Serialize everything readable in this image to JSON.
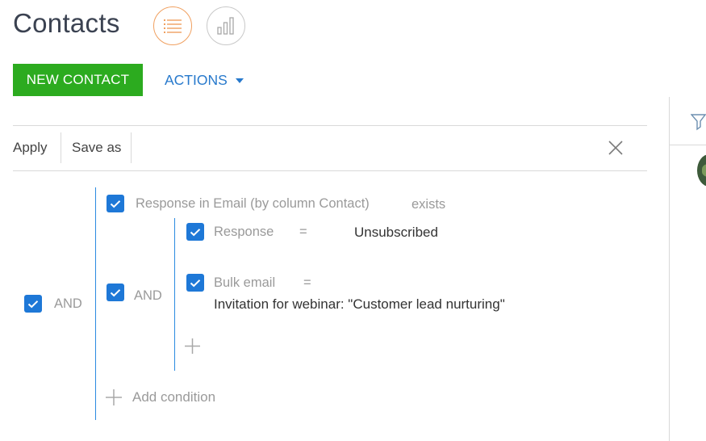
{
  "header": {
    "title": "Contacts"
  },
  "toolbar": {
    "new_contact_label": "NEW CONTACT",
    "actions_label": "ACTIONS"
  },
  "filter_toolbar": {
    "apply_label": "Apply",
    "save_as_label": "Save as"
  },
  "filter": {
    "root_operator": "AND",
    "group_operator": "AND",
    "exists_condition": {
      "column": "Response in Email (by column Contact)",
      "operator": "exists"
    },
    "conditions": [
      {
        "column": "Response",
        "operator": "=",
        "value": "Unsubscribed"
      },
      {
        "column": "Bulk email",
        "operator": "=",
        "value": "Invitation for webinar: \"Customer lead nurturing\""
      }
    ],
    "add_condition_label": "Add condition"
  },
  "colors": {
    "accent_green": "#2cab1f",
    "link_blue": "#2779cc",
    "checkbox_blue": "#1e78d7",
    "active_view_orange": "#f0a060"
  }
}
